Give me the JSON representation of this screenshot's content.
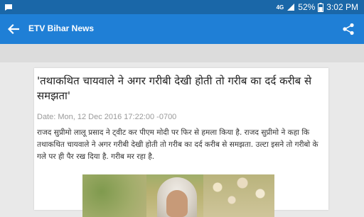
{
  "status_bar": {
    "signal_label": "4G",
    "battery": "52%",
    "time": "3:02 PM",
    "icons": [
      "notification-icon",
      "signal-icon",
      "battery-icon"
    ]
  },
  "app_bar": {
    "title": "ETV Bihar News",
    "back_icon": "arrow-left-icon",
    "share_icon": "share-icon"
  },
  "article": {
    "headline": "'तथाकथित चायवाले ने अगर गरीबी देखी होती तो गरीब का दर्द करीब से समझता'",
    "date": "Date: Mon, 12 Dec 2016 17:22:00 -0700",
    "body": "राजद सुप्रीमो लालू प्रसाद ने ट्वीट कर पीएम मोदी पर फिर से हमला किया है. राजद सुप्रीमो ने कहा कि तथाकथित चायवाले ने अगर गरीबी देखी होती तो गरीब का दर्द करीब से समझता. उल्टा इसने तो गरीबो के गले पर ही पैर रख दिया है. गरीब मर रहा है."
  },
  "colors": {
    "status_bar": "#1a67a8",
    "app_bar": "#1f7fd6",
    "page_background": "#e9e9e9",
    "card_background": "#ffffff",
    "date_text": "#9a9a9a"
  }
}
